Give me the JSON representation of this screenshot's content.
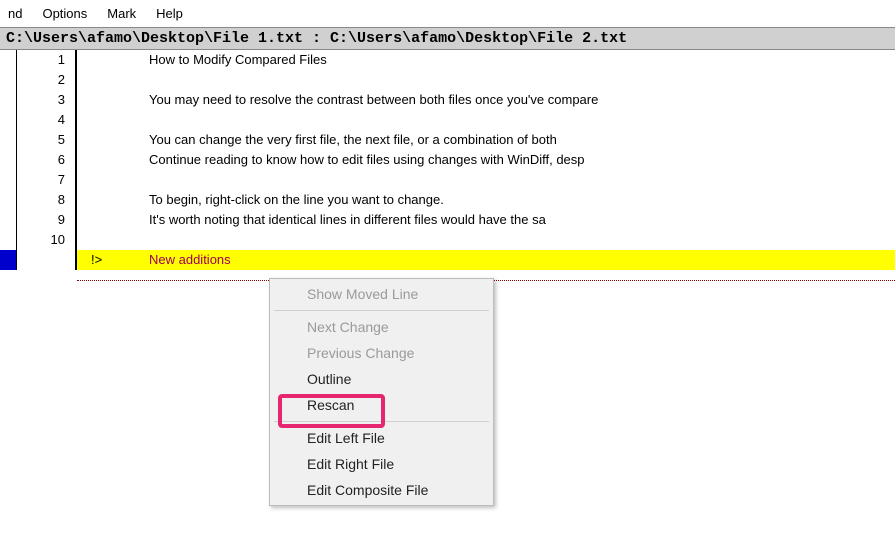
{
  "menu": {
    "items": [
      "nd",
      "Options",
      "Mark",
      "Help"
    ]
  },
  "titlebar": "C:\\Users\\afamo\\Desktop\\File 1.txt : C:\\Users\\afamo\\Desktop\\File 2.txt",
  "lines": [
    {
      "n": "1",
      "marker": "",
      "text": "How to Modify Compared Files",
      "diff": false
    },
    {
      "n": "2",
      "marker": "",
      "text": "",
      "diff": false
    },
    {
      "n": "3",
      "marker": "",
      "text": "You may need to resolve the contrast between both files once you've compare",
      "diff": false
    },
    {
      "n": "4",
      "marker": "",
      "text": "",
      "diff": false
    },
    {
      "n": "5",
      "marker": "",
      "text": "You can change the very first file, the next file, or a combination of both",
      "diff": false
    },
    {
      "n": "6",
      "marker": "",
      "text": "Continue reading to know how to edit files using changes with WinDiff, desp",
      "diff": false
    },
    {
      "n": "7",
      "marker": "",
      "text": "",
      "diff": false
    },
    {
      "n": "8",
      "marker": "",
      "text": "To begin, right-click on the line you want to change.",
      "diff": false
    },
    {
      "n": "9",
      "marker": "",
      "text": "It's worth noting that identical lines in different files would have the sa",
      "diff": false
    },
    {
      "n": "10",
      "marker": "",
      "text": "",
      "diff": false
    },
    {
      "n": "",
      "marker": "!>",
      "text": "New additions",
      "diff": true
    }
  ],
  "contextmenu": {
    "items": [
      {
        "label": "Show Moved Line",
        "disabled": true,
        "name": "ctx-show-moved-line"
      },
      {
        "sep": true
      },
      {
        "label": "Next Change",
        "disabled": true,
        "name": "ctx-next-change"
      },
      {
        "label": "Previous Change",
        "disabled": true,
        "name": "ctx-previous-change"
      },
      {
        "label": "Outline",
        "disabled": false,
        "name": "ctx-outline"
      },
      {
        "label": "Rescan",
        "disabled": false,
        "name": "ctx-rescan",
        "highlighted": true
      },
      {
        "sep": true
      },
      {
        "label": "Edit Left File",
        "disabled": false,
        "name": "ctx-edit-left"
      },
      {
        "label": "Edit Right File",
        "disabled": false,
        "name": "ctx-edit-right"
      },
      {
        "label": "Edit Composite File",
        "disabled": false,
        "name": "ctx-edit-composite"
      }
    ]
  }
}
